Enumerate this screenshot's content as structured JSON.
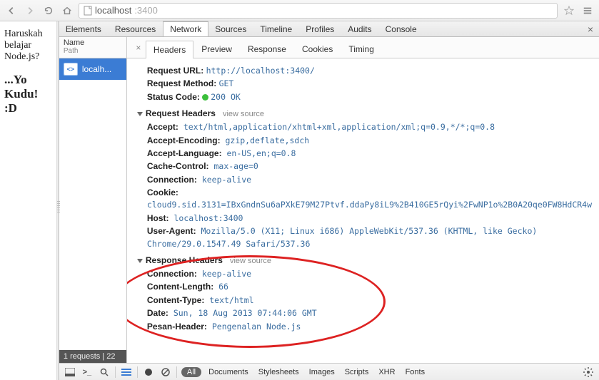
{
  "url": {
    "prefix": "localhost",
    "rest": ":3400"
  },
  "page": {
    "question": "Haruskah belajar Node.js?",
    "heading": "...Yo Kudu! :D"
  },
  "devtools_tabs": [
    "Elements",
    "Resources",
    "Network",
    "Sources",
    "Timeline",
    "Profiles",
    "Audits",
    "Console"
  ],
  "active_devtools_tab": "Network",
  "req_header": {
    "name": "Name",
    "path": "Path"
  },
  "req_item_label": "localh...",
  "req_footer": "1 requests  |  22",
  "detail_tabs": [
    "Headers",
    "Preview",
    "Response",
    "Cookies",
    "Timing"
  ],
  "active_detail_tab": "Headers",
  "general": {
    "url_label": "Request URL:",
    "url": "http://localhost:3400/",
    "method_label": "Request Method:",
    "method": "GET",
    "status_label": "Status Code:",
    "status": "200 OK"
  },
  "req_headers_title": "Request Headers",
  "view_source": "view source",
  "req_headers": [
    {
      "k": "Accept:",
      "v": "text/html,application/xhtml+xml,application/xml;q=0.9,*/*;q=0.8"
    },
    {
      "k": "Accept-Encoding:",
      "v": "gzip,deflate,sdch"
    },
    {
      "k": "Accept-Language:",
      "v": "en-US,en;q=0.8"
    },
    {
      "k": "Cache-Control:",
      "v": "max-age=0"
    },
    {
      "k": "Connection:",
      "v": "keep-alive"
    },
    {
      "k": "Cookie:",
      "v": "cloud9.sid.3131=IBxGndnSu6aPXkE79M27Ptvf.ddaPy8iL9%2B410GE5rQyi%2FwNP1o%2B0A20qe0FW8HdCR4w"
    },
    {
      "k": "Host:",
      "v": "localhost:3400"
    },
    {
      "k": "User-Agent:",
      "v": "Mozilla/5.0 (X11; Linux i686) AppleWebKit/537.36 (KHTML, like Gecko) Chrome/29.0.1547.49 Safari/537.36"
    }
  ],
  "resp_headers_title": "Response Headers",
  "resp_headers": [
    {
      "k": "Connection:",
      "v": "keep-alive"
    },
    {
      "k": "Content-Length:",
      "v": "66"
    },
    {
      "k": "Content-Type:",
      "v": "text/html"
    },
    {
      "k": "Date:",
      "v": "Sun, 18 Aug 2013 07:44:06 GMT"
    },
    {
      "k": "Pesan-Header:",
      "v": "Pengenalan Node.js"
    }
  ],
  "footer_filters": {
    "all": "All",
    "items": [
      "Documents",
      "Stylesheets",
      "Images",
      "Scripts",
      "XHR",
      "Fonts"
    ]
  }
}
